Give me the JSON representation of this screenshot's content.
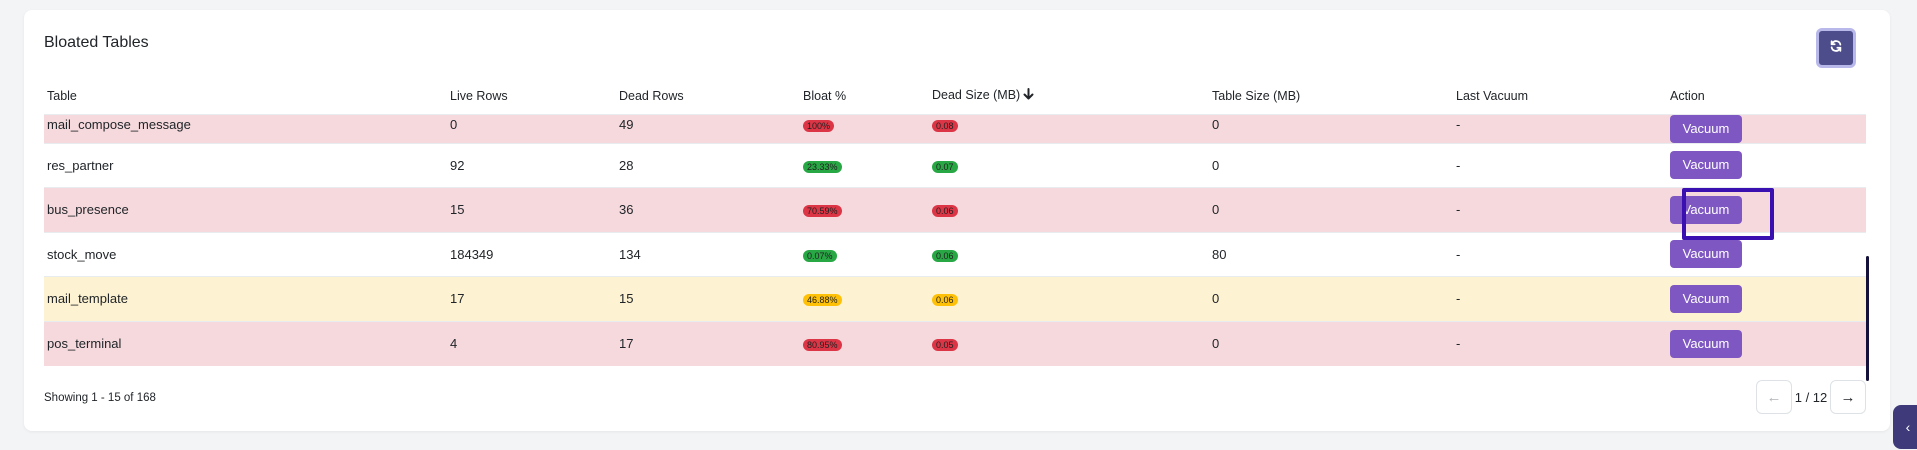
{
  "card": {
    "title": "Bloated Tables"
  },
  "refresh": {
    "icon": "refresh-icon"
  },
  "table": {
    "headers": {
      "table": "Table",
      "live_rows": "Live Rows",
      "dead_rows": "Dead Rows",
      "bloat": "Bloat %",
      "dead_size": "Dead Size (MB)",
      "table_size": "Table Size (MB)",
      "last_vacuum": "Last Vacuum",
      "action": "Action"
    },
    "rows": [
      {
        "name": "mail_compose_message",
        "live": "0",
        "dead": "49",
        "bloat": "100%",
        "dead_size": "0.08",
        "size": "0",
        "last": "-",
        "action": "Vacuum"
      },
      {
        "name": "res_partner",
        "live": "92",
        "dead": "28",
        "bloat": "23.33%",
        "dead_size": "0.07",
        "size": "0",
        "last": "-",
        "action": "Vacuum"
      },
      {
        "name": "bus_presence",
        "live": "15",
        "dead": "36",
        "bloat": "70.59%",
        "dead_size": "0.06",
        "size": "0",
        "last": "-",
        "action": "Vacuum"
      },
      {
        "name": "stock_move",
        "live": "184349",
        "dead": "134",
        "bloat": "0.07%",
        "dead_size": "0.06",
        "size": "80",
        "last": "-",
        "action": "Vacuum"
      },
      {
        "name": "mail_template",
        "live": "17",
        "dead": "15",
        "bloat": "46.88%",
        "dead_size": "0.06",
        "size": "0",
        "last": "-",
        "action": "Vacuum"
      },
      {
        "name": "pos_terminal",
        "live": "4",
        "dead": "17",
        "bloat": "80.95%",
        "dead_size": "0.05",
        "size": "0",
        "last": "-",
        "action": "Vacuum"
      }
    ]
  },
  "footer": {
    "showing": "Showing 1 - 15 of 168",
    "page_label": "1 / 12",
    "prev": "←",
    "next": "→"
  },
  "side_tab": {
    "glyph": "‹"
  },
  "colors": {
    "row_red": "#f5d9dc",
    "row_yellow": "#fdf2d1",
    "badge_red": "#dc3545",
    "badge_green": "#28a745",
    "badge_yellow": "#ffc107",
    "vacuum_button": "#7e57c2",
    "refresh_button": "#4c4d8a"
  }
}
